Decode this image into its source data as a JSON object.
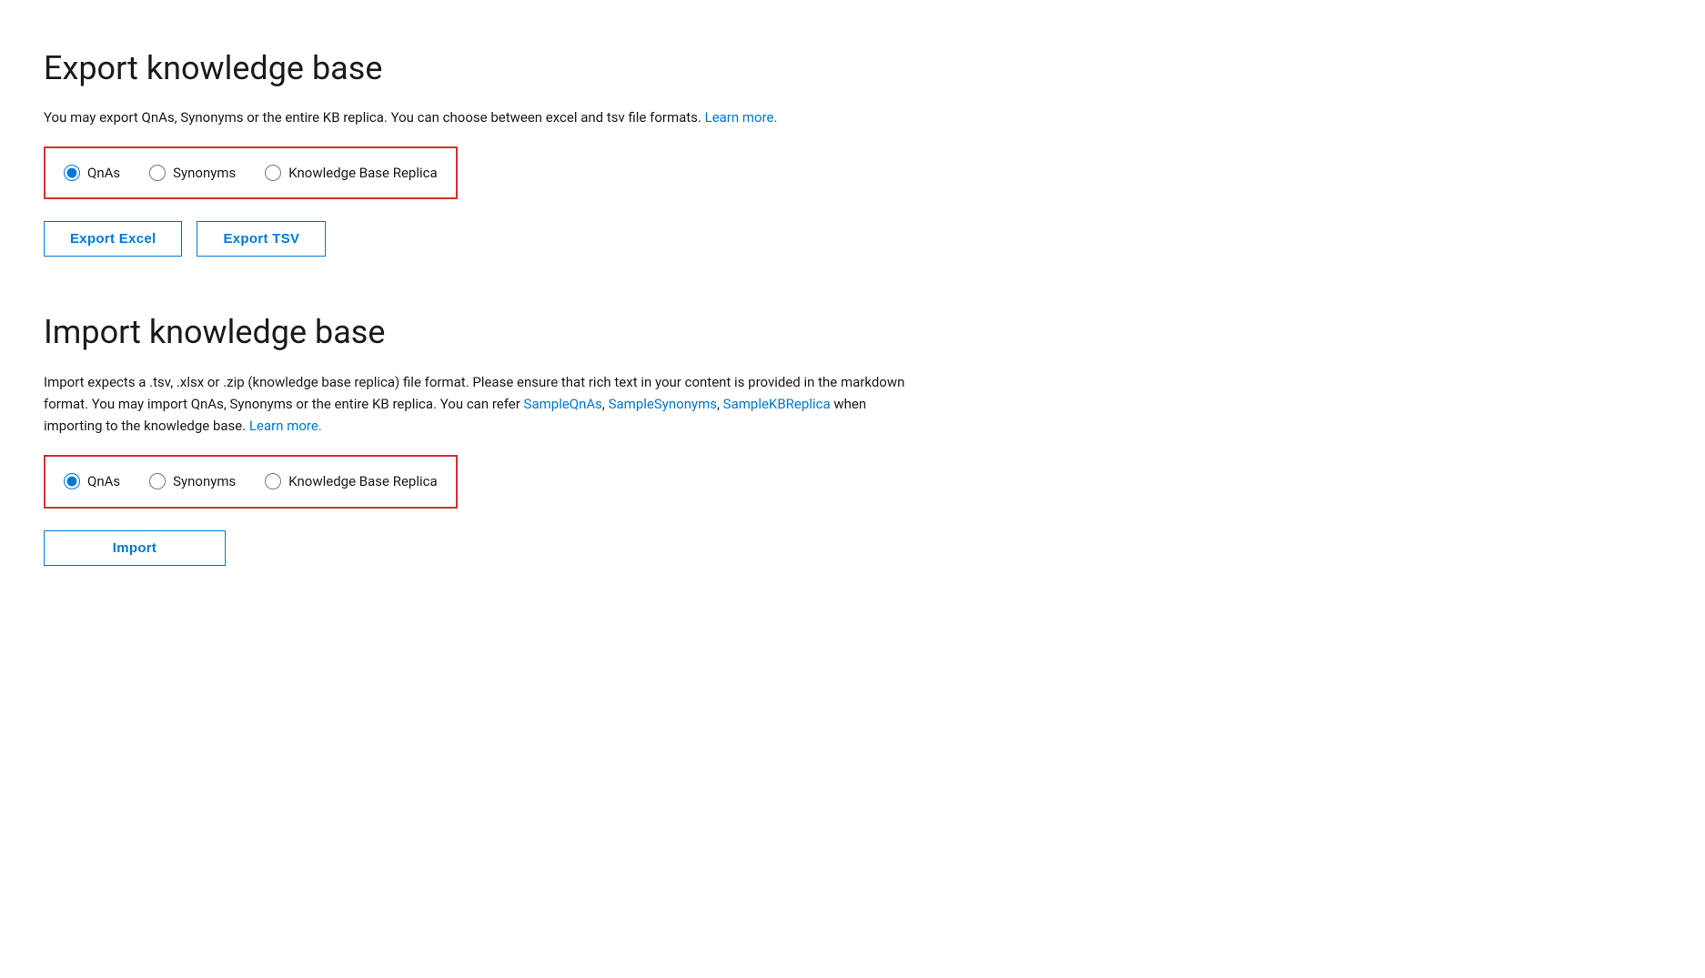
{
  "export_section": {
    "title": "Export knowledge base",
    "description_parts": [
      "You may export QnAs, Synonyms or the entire KB replica. You can choose between excel and tsv file formats.",
      " ",
      "Learn more."
    ],
    "description_text": "You may export QnAs, Synonyms or the entire KB replica. You can choose between excel and tsv file formats.",
    "learn_more_label": "Learn more.",
    "radio_options": [
      {
        "id": "export-qnas",
        "label": "QnAs",
        "checked": true
      },
      {
        "id": "export-synonyms",
        "label": "Synonyms",
        "checked": false
      },
      {
        "id": "export-kbreplica",
        "label": "Knowledge Base Replica",
        "checked": false
      }
    ],
    "export_excel_label": "Export Excel",
    "export_tsv_label": "Export TSV"
  },
  "import_section": {
    "title": "Import knowledge base",
    "description_text": "Import expects a .tsv, .xlsx or .zip (knowledge base replica) file format. Please ensure that rich text in your content is provided in the markdown format. You may import QnAs, Synonyms or the entire KB replica. You can refer",
    "sample_qnas_label": "SampleQnAs",
    "sample_synonyms_label": "SampleSynonyms",
    "sample_kbreplica_label": "SampleKBReplica",
    "description_suffix": "when importing to the knowledge base.",
    "learn_more_label": "Learn more.",
    "radio_options": [
      {
        "id": "import-qnas",
        "label": "QnAs",
        "checked": true
      },
      {
        "id": "import-synonyms",
        "label": "Synonyms",
        "checked": false
      },
      {
        "id": "import-kbreplica",
        "label": "Knowledge Base Replica",
        "checked": false
      }
    ],
    "import_button_label": "Import"
  }
}
